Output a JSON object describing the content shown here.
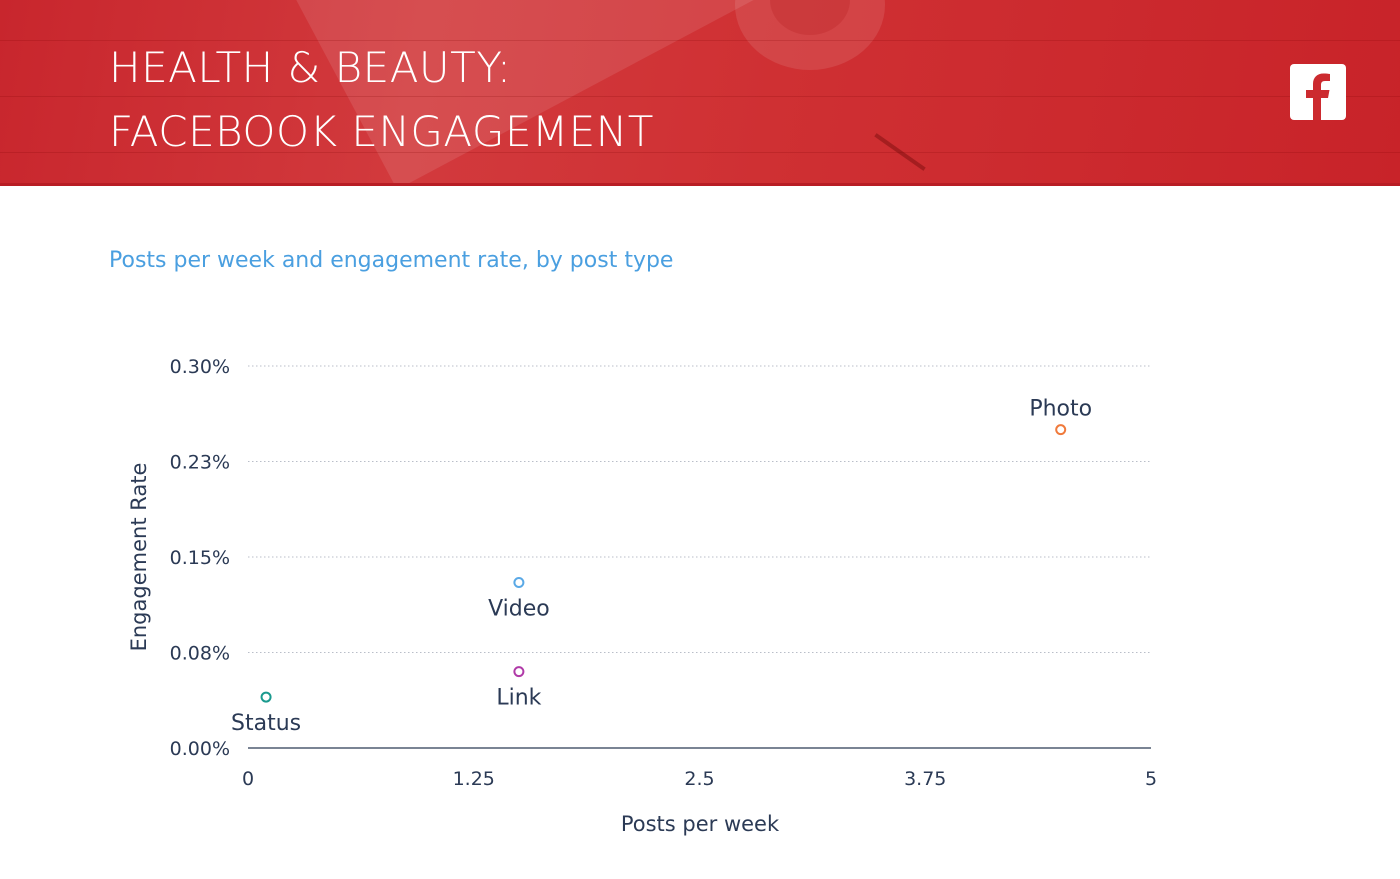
{
  "header": {
    "title_line1": "HEALTH & BEAUTY:",
    "title_line2": "FACEBOOK ENGAGEMENT",
    "logo_icon": "facebook-icon",
    "background_color": "#cc2a2f"
  },
  "subtitle": "Posts per week and engagement rate, by post type",
  "chart_data": {
    "type": "scatter",
    "title": "Posts per week and engagement rate, by post type",
    "xlabel": "Posts per week",
    "ylabel": "Engagement Rate",
    "xlim": [
      0,
      5
    ],
    "ylim": [
      0,
      0.3
    ],
    "x_ticks": [
      0,
      1.25,
      2.5,
      3.75,
      5
    ],
    "x_tick_labels": [
      "0",
      "1.25",
      "2.5",
      "3.75",
      "5"
    ],
    "y_ticks": [
      0,
      0.075,
      0.15,
      0.225,
      0.3
    ],
    "y_tick_labels": [
      "0.00%",
      "0.08%",
      "0.15%",
      "0.23%",
      "0.30%"
    ],
    "grid": "horizontal-dotted",
    "points": [
      {
        "label": "Photo",
        "x": 4.5,
        "y": 0.25,
        "color": "#f07a3c",
        "label_position": "above"
      },
      {
        "label": "Video",
        "x": 1.5,
        "y": 0.13,
        "color": "#5aa9e6",
        "label_position": "below"
      },
      {
        "label": "Link",
        "x": 1.5,
        "y": 0.06,
        "color": "#b03aa8",
        "label_position": "below"
      },
      {
        "label": "Status",
        "x": 0.1,
        "y": 0.04,
        "color": "#1a9a8e",
        "label_position": "below"
      }
    ]
  }
}
